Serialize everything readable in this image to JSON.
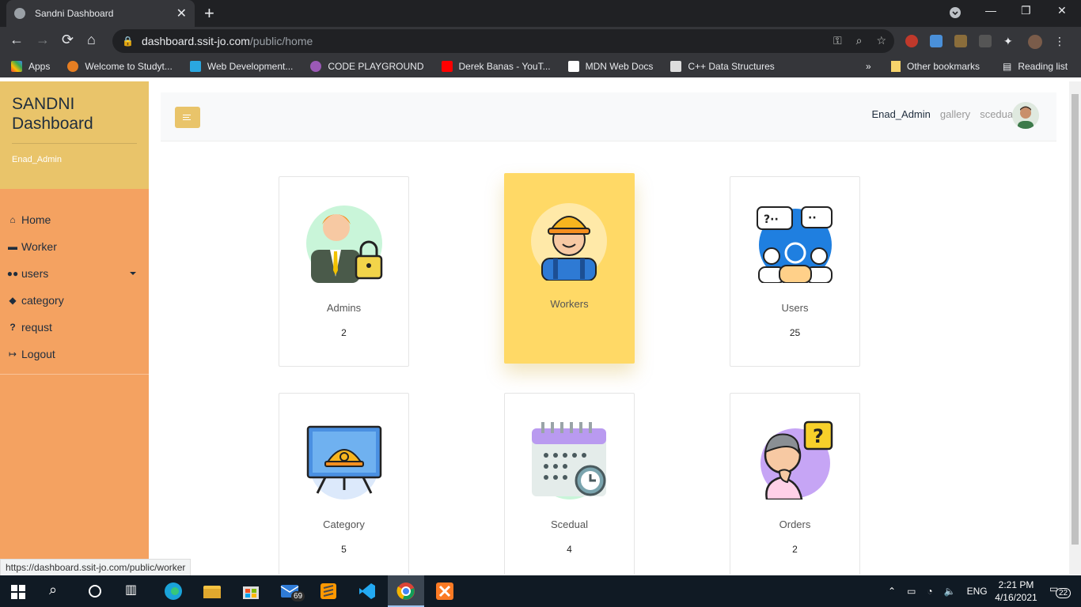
{
  "browser": {
    "tab_title": "Sandni Dashboard",
    "url_host": "dashboard.ssit-jo.com",
    "url_path": "/public/home",
    "bookmarks": [
      "Apps",
      "Welcome to Studyt...",
      "Web Development...",
      "CODE PLAYGROUND",
      "Derek Banas - YouT...",
      "MDN Web Docs",
      "C++ Data Structures"
    ],
    "other_bookmarks": "Other bookmarks",
    "reading_list": "Reading list",
    "status_url": "https://dashboard.ssit-jo.com/public/worker"
  },
  "sidebar": {
    "title_line1": "SANDNI",
    "title_line2": "Dashboard",
    "user": "Enad_Admin",
    "items": [
      {
        "label": "Home",
        "icon": "home-icon"
      },
      {
        "label": "Worker",
        "icon": "briefcase-icon"
      },
      {
        "label": "users",
        "icon": "users-icon"
      },
      {
        "label": "category",
        "icon": "tags-icon"
      },
      {
        "label": "requst",
        "icon": "question-icon"
      },
      {
        "label": "Logout",
        "icon": "sign-out-icon"
      }
    ]
  },
  "topnav": {
    "user": "Enad_Admin",
    "links": [
      "gallery",
      "scedual"
    ]
  },
  "cards": [
    {
      "label": "Admins",
      "count": "2"
    },
    {
      "label": "Workers",
      "count": ""
    },
    {
      "label": "Users",
      "count": "25"
    },
    {
      "label": "Category",
      "count": "5"
    },
    {
      "label": "Scedual",
      "count": "4"
    },
    {
      "label": "Orders",
      "count": "2"
    }
  ],
  "taskbar": {
    "mail_badge": "69",
    "language": "ENG",
    "time": "2:21 PM",
    "date": "4/16/2021",
    "notifications": "22"
  },
  "colors": {
    "sidebar": "#f4a261",
    "sidebar_head": "#e9c46a",
    "highlight_card": "#ffd966"
  }
}
